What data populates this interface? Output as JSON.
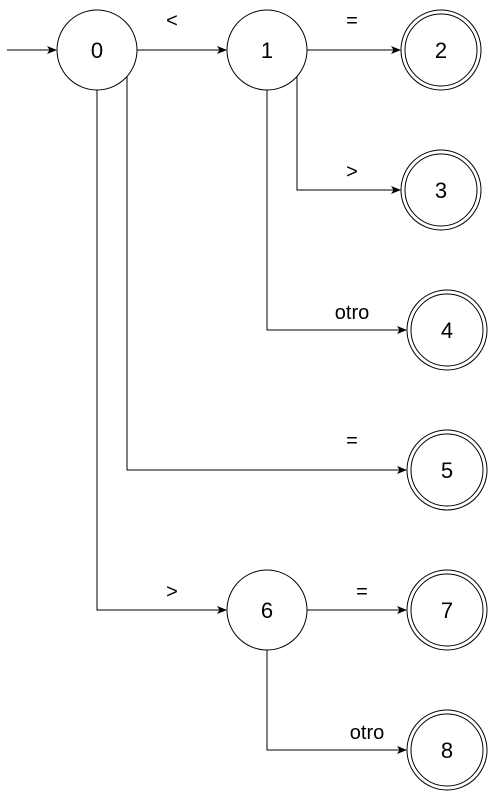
{
  "states": {
    "s0": "0",
    "s1": "1",
    "s2": "2",
    "s3": "3",
    "s4": "4",
    "s5": "5",
    "s6": "6",
    "s7": "7",
    "s8": "8"
  },
  "transitions": {
    "t0_1": "<",
    "t1_2": "=",
    "t1_3": ">",
    "t1_4": "otro",
    "t0_5": "=",
    "t0_6": ">",
    "t6_7": "=",
    "t6_8": "otro"
  }
}
